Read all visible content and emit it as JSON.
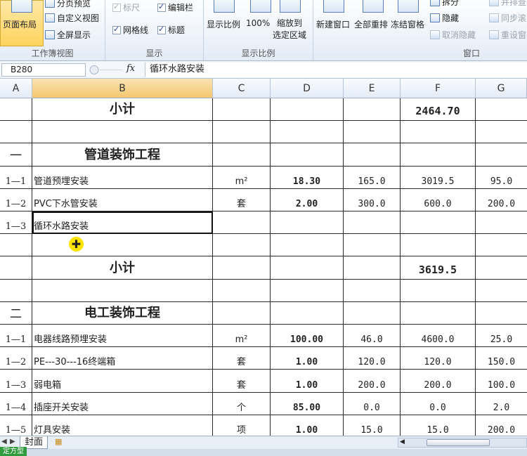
{
  "ribbon": {
    "workbook_view_group": {
      "label": "工作簿视图",
      "page_layout": "页面布局",
      "page_break_preview": "分页预览",
      "custom_views": "自定义视图",
      "full_screen": "全屏显示"
    },
    "show_group": {
      "label": "显示",
      "ruler": "标尺",
      "formula_bar": "编辑栏",
      "gridlines": "网格线",
      "headings": "标题"
    },
    "zoom_group": {
      "label": "显示比例",
      "zoom": "显示比例",
      "hundred": "100%",
      "zoom_to_selection_1": "缩放到",
      "zoom_to_selection_2": "选定区域"
    },
    "window_group": {
      "label": "窗口",
      "new_window": "新建窗口",
      "arrange_all": "全部重排",
      "freeze_panes": "冻结窗格",
      "split": "拆分",
      "hide": "隐藏",
      "unhide": "取消隐藏",
      "view_side_by_side": "并排查看",
      "synchronous_scrolling": "同步滚",
      "reset_window_position": "重设窗"
    }
  },
  "formula_bar": {
    "name_box": "B280",
    "fx": "fx",
    "content": "循环水路安装"
  },
  "columns": [
    "A",
    "B",
    "C",
    "D",
    "E",
    "F",
    "G"
  ],
  "rows": [
    {
      "a": "",
      "b": "小计",
      "c": "",
      "d": "",
      "e": "",
      "f": "2464.70",
      "g": "",
      "type": "subtotal"
    },
    {
      "a": "",
      "b": "",
      "c": "",
      "d": "",
      "e": "",
      "f": "",
      "g": "",
      "type": "blank"
    },
    {
      "a": "一",
      "b": "管道装饰工程",
      "c": "",
      "d": "",
      "e": "",
      "f": "",
      "g": "",
      "type": "section"
    },
    {
      "a": "1—1",
      "b": "管道预埋安装",
      "c": "m²",
      "d": "18.30",
      "e": "165.0",
      "f": "3019.5",
      "g": "95.0",
      "type": "item"
    },
    {
      "a": "1—2",
      "b": "PVC下水管安装",
      "c": "套",
      "d": "2.00",
      "e": "300.0",
      "f": "600.0",
      "g": "200.0",
      "type": "item"
    },
    {
      "a": "1—3",
      "b": "循环水路安装",
      "c": "",
      "d": "",
      "e": "",
      "f": "",
      "g": "",
      "type": "item",
      "active": true
    },
    {
      "a": "",
      "b": "",
      "c": "",
      "d": "",
      "e": "",
      "f": "",
      "g": "",
      "type": "blank"
    },
    {
      "a": "",
      "b": "小计",
      "c": "",
      "d": "",
      "e": "",
      "f": "3619.5",
      "g": "",
      "type": "subtotal"
    },
    {
      "a": "",
      "b": "",
      "c": "",
      "d": "",
      "e": "",
      "f": "",
      "g": "",
      "type": "blank"
    },
    {
      "a": "二",
      "b": "电工装饰工程",
      "c": "",
      "d": "",
      "e": "",
      "f": "",
      "g": "",
      "type": "section"
    },
    {
      "a": "1—1",
      "b": "电器线路预埋安装",
      "c": "m²",
      "d": "100.00",
      "e": "46.0",
      "f": "4600.0",
      "g": "25.0",
      "type": "item"
    },
    {
      "a": "1—2",
      "b": "PE---30---16终端箱",
      "c": "套",
      "d": "1.00",
      "e": "120.0",
      "f": "120.0",
      "g": "150.0",
      "type": "item"
    },
    {
      "a": "1—3",
      "b": "弱电箱",
      "c": "套",
      "d": "1.00",
      "e": "200.0",
      "f": "200.0",
      "g": "100.0",
      "type": "item"
    },
    {
      "a": "1—4",
      "b": "插座开关安装",
      "c": "个",
      "d": "85.00",
      "e": "0.0",
      "f": "0.0",
      "g": "2.0",
      "type": "item"
    },
    {
      "a": "1—5",
      "b": "灯具安装",
      "c": "项",
      "d": "1.00",
      "e": "15.0",
      "f": "15.0",
      "g": "200.0",
      "type": "item"
    }
  ],
  "sheet_tabs": {
    "active": "封面"
  },
  "status": {
    "label": "定方型"
  }
}
